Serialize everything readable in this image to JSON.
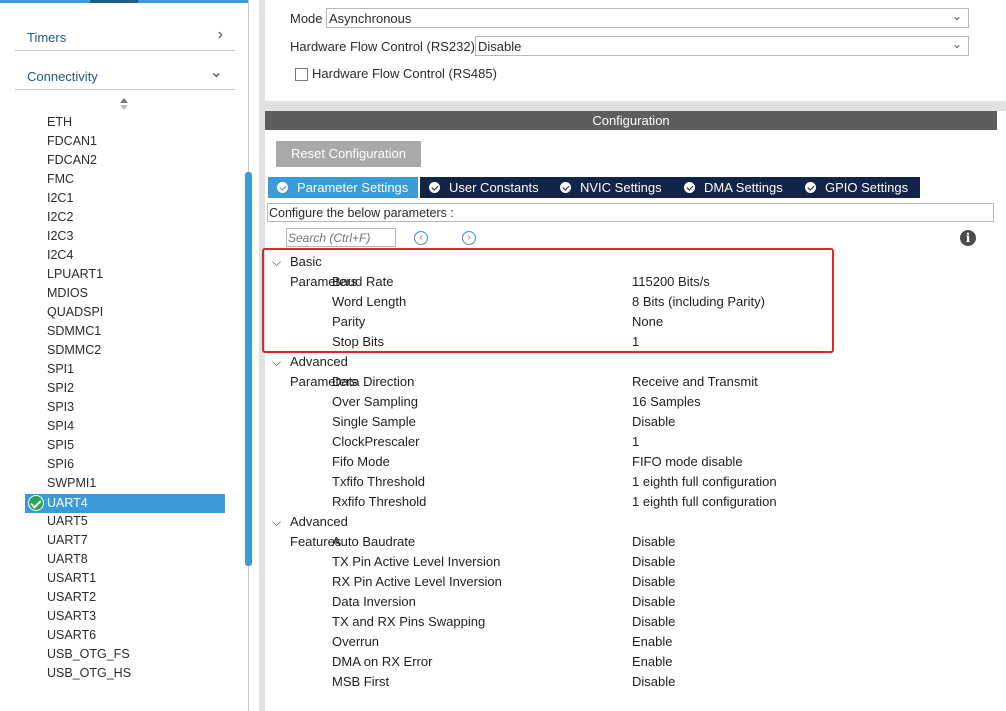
{
  "sidebar": {
    "categories": [
      {
        "label": "Timers",
        "chevron": "›"
      },
      {
        "label": "Connectivity",
        "chevron": "⌄"
      }
    ],
    "peripherals": [
      "ETH",
      "FDCAN1",
      "FDCAN2",
      "FMC",
      "I2C1",
      "I2C2",
      "I2C3",
      "I2C4",
      "LPUART1",
      "MDIOS",
      "QUADSPI",
      "SDMMC1",
      "SDMMC2",
      "SPI1",
      "SPI2",
      "SPI3",
      "SPI4",
      "SPI5",
      "SPI6",
      "SWPMI1",
      "UART4",
      "UART5",
      "UART7",
      "UART8",
      "USART1",
      "USART2",
      "USART3",
      "USART6",
      "USB_OTG_FS",
      "USB_OTG_HS"
    ],
    "selected": "UART4",
    "selected_index": 20
  },
  "mode_section": {
    "mode_label": "Mode",
    "mode_value": "Asynchronous",
    "flow_label": "Hardware Flow Control (RS232)",
    "flow_value": "Disable",
    "rs485_label": "Hardware Flow Control (RS485)",
    "rs485_checked": false
  },
  "config": {
    "title": "Configuration",
    "reset_button": "Reset Configuration",
    "tabs": [
      "Parameter Settings",
      "User Constants",
      "NVIC Settings",
      "DMA Settings",
      "GPIO Settings"
    ],
    "active_tab": 0,
    "description": "Configure the below parameters :",
    "search_placeholder": "Search (Ctrl+F)",
    "groups": [
      {
        "name": "Basic Parameters",
        "params": [
          {
            "key": "Baud Rate",
            "value": "115200 Bits/s"
          },
          {
            "key": "Word Length",
            "value": "8 Bits (including Parity)"
          },
          {
            "key": "Parity",
            "value": "None"
          },
          {
            "key": "Stop Bits",
            "value": "1"
          }
        ]
      },
      {
        "name": "Advanced Parameters",
        "params": [
          {
            "key": "Data Direction",
            "value": "Receive and Transmit"
          },
          {
            "key": "Over Sampling",
            "value": "16 Samples"
          },
          {
            "key": "Single Sample",
            "value": "Disable"
          },
          {
            "key": "ClockPrescaler",
            "value": "1"
          },
          {
            "key": "Fifo Mode",
            "value": "FIFO mode disable"
          },
          {
            "key": "Txfifo Threshold",
            "value": "1 eighth full configuration"
          },
          {
            "key": "Rxfifo Threshold",
            "value": "1 eighth full configuration"
          }
        ]
      },
      {
        "name": "Advanced Features",
        "params": [
          {
            "key": "Auto Baudrate",
            "value": "Disable"
          },
          {
            "key": "TX Pin Active Level Inversion",
            "value": "Disable"
          },
          {
            "key": "RX Pin Active Level Inversion",
            "value": "Disable"
          },
          {
            "key": "Data Inversion",
            "value": "Disable"
          },
          {
            "key": "TX and RX Pins Swapping",
            "value": "Disable"
          },
          {
            "key": "Overrun",
            "value": "Enable"
          },
          {
            "key": "DMA on RX Error",
            "value": "Enable"
          },
          {
            "key": "MSB First",
            "value": "Disable"
          }
        ]
      }
    ]
  },
  "colors": {
    "accent_blue": "#3b9ad8",
    "tab_dark": "#13244a",
    "config_bar": "#5d5d5d",
    "highlight_red": "#e0252b",
    "check_green": "#27a35a"
  },
  "icons": {
    "category_expand": "chevron-right-icon",
    "category_collapse": "chevron-down-icon",
    "tab_check": "check-circle-icon",
    "search_prev": "circle-left-icon",
    "search_next": "circle-right-icon",
    "info": "info-icon",
    "group_toggle": "chevron-down-icon"
  }
}
